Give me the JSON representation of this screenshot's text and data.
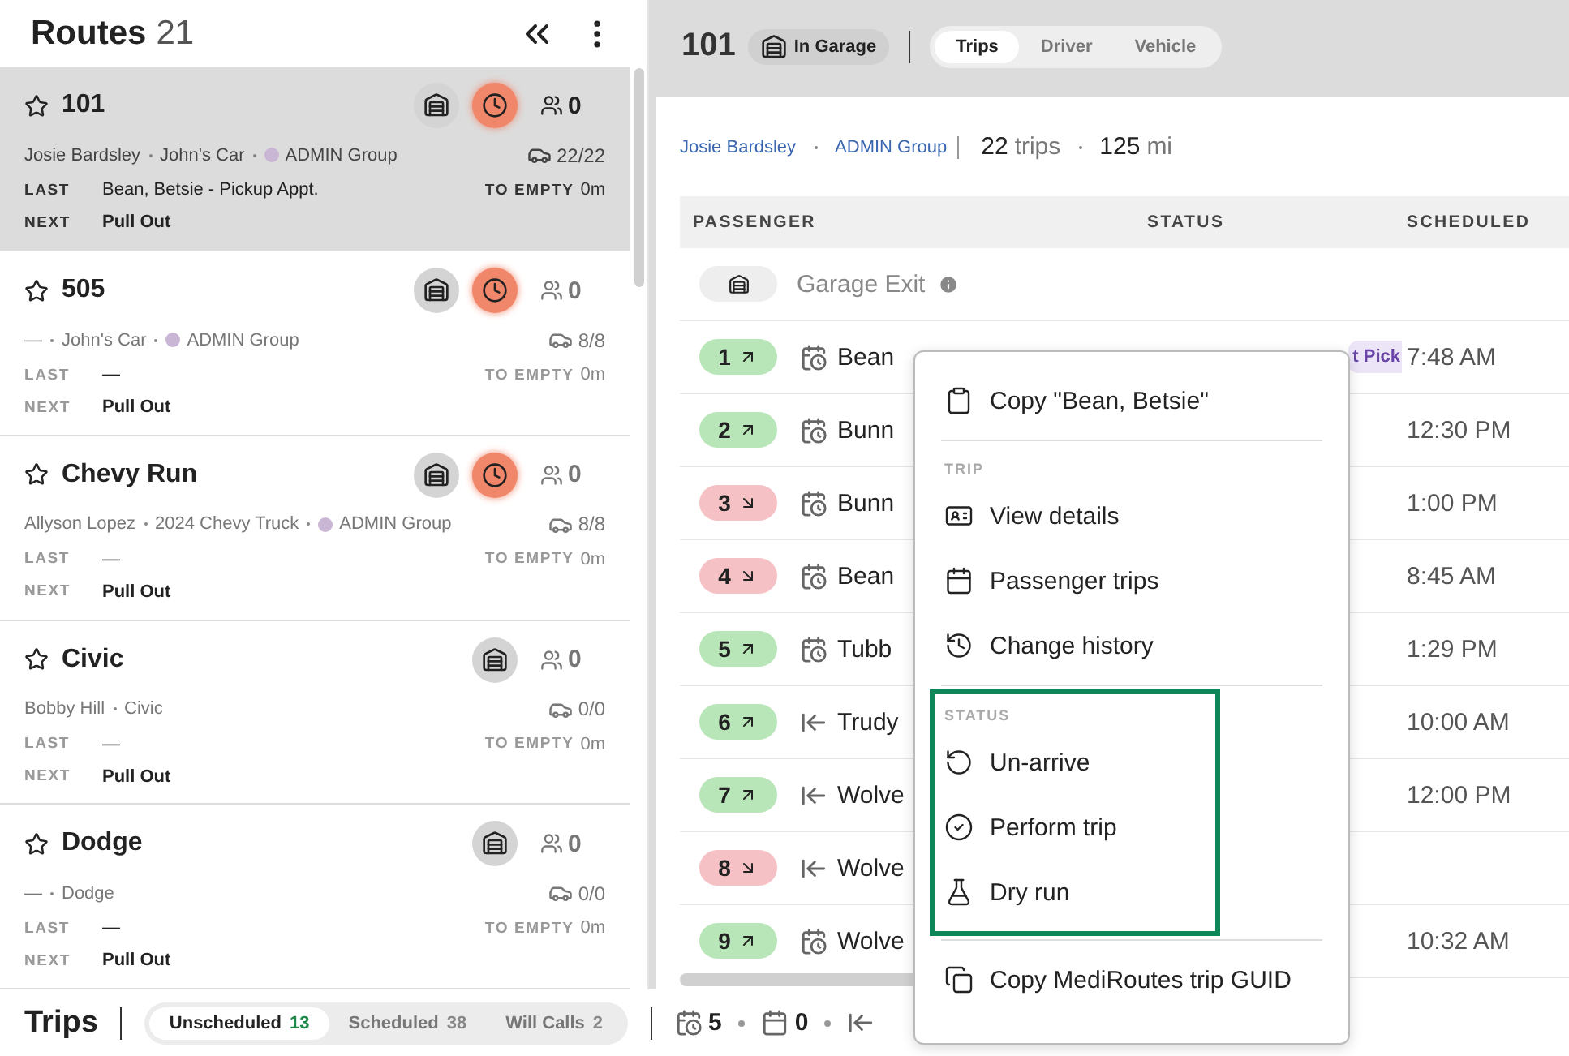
{
  "routes_header": {
    "title": "Routes",
    "count": "21"
  },
  "routes": [
    {
      "name": "101",
      "selected": true,
      "late": true,
      "passengers": "0",
      "details": [
        {
          "text": "Josie Bardsley"
        },
        {
          "text": "John's Car"
        },
        {
          "text": "ADMIN Group",
          "color": "#c9b6d4"
        }
      ],
      "capacity": "22/22",
      "last_label": "LAST",
      "last": "Bean, Betsie - Pickup Appt.",
      "to_empty_label": "TO EMPTY",
      "to_empty": "0m",
      "next_label": "NEXT",
      "next": "Pull Out"
    },
    {
      "name": "505",
      "selected": false,
      "late": true,
      "passengers": "0",
      "details": [
        {
          "text": "—"
        },
        {
          "text": "John's Car"
        },
        {
          "text": "ADMIN Group",
          "color": "#c9b6d4"
        }
      ],
      "capacity": "8/8",
      "last_label": "LAST",
      "last": "—",
      "to_empty_label": "TO EMPTY",
      "to_empty": "0m",
      "next_label": "NEXT",
      "next": "Pull Out"
    },
    {
      "name": "Chevy Run",
      "selected": false,
      "late": true,
      "passengers": "0",
      "details": [
        {
          "text": "Allyson Lopez"
        },
        {
          "text": "2024 Chevy Truck"
        },
        {
          "text": "ADMIN Group",
          "color": "#c9b6d4"
        }
      ],
      "capacity": "8/8",
      "last_label": "LAST",
      "last": "—",
      "to_empty_label": "TO EMPTY",
      "to_empty": "0m",
      "next_label": "NEXT",
      "next": "Pull Out"
    },
    {
      "name": "Civic",
      "selected": false,
      "late": false,
      "passengers": "0",
      "details": [
        {
          "text": "Bobby Hill"
        },
        {
          "text": "Civic"
        }
      ],
      "capacity": "0/0",
      "last_label": "LAST",
      "last": "—",
      "to_empty_label": "TO EMPTY",
      "to_empty": "0m",
      "next_label": "NEXT",
      "next": "Pull Out"
    },
    {
      "name": "Dodge",
      "selected": false,
      "late": false,
      "passengers": "0",
      "details": [
        {
          "text": "—"
        },
        {
          "text": "Dodge"
        }
      ],
      "capacity": "0/0",
      "last_label": "LAST",
      "last": "—",
      "to_empty_label": "TO EMPTY",
      "to_empty": "0m",
      "next_label": "NEXT",
      "next": "Pull Out"
    }
  ],
  "detail_header": {
    "route": "101",
    "status": "In Garage",
    "tabs": [
      {
        "label": "Trips",
        "selected": true
      },
      {
        "label": "Driver",
        "selected": false
      },
      {
        "label": "Vehicle",
        "selected": false
      }
    ]
  },
  "summary": {
    "driver": "Josie Bardsley",
    "group": "ADMIN Group",
    "trips": "22",
    "trips_unit": "trips",
    "miles": "125",
    "miles_unit": "mi"
  },
  "table": {
    "columns": [
      "PASSENGER",
      "STATUS",
      "SCHEDULED"
    ],
    "garage_row": {
      "label": "Garage Exit"
    },
    "rows": [
      {
        "number": "1",
        "pickup": true,
        "kind": "appointment",
        "passenger": "Bean",
        "status": "t Pick",
        "scheduled": "7:48 AM"
      },
      {
        "number": "2",
        "pickup": true,
        "kind": "appointment",
        "passenger": "Bunn",
        "scheduled": "12:30 PM"
      },
      {
        "number": "3",
        "pickup": false,
        "kind": "appointment",
        "passenger": "Bunn",
        "scheduled": "1:00 PM"
      },
      {
        "number": "4",
        "pickup": false,
        "kind": "appointment",
        "passenger": "Bean",
        "scheduled": "8:45 AM"
      },
      {
        "number": "5",
        "pickup": true,
        "kind": "appointment",
        "passenger": "Tubb",
        "scheduled": "1:29 PM"
      },
      {
        "number": "6",
        "pickup": true,
        "kind": "return",
        "passenger": "Trudy",
        "scheduled": "10:00 AM"
      },
      {
        "number": "7",
        "pickup": true,
        "kind": "return",
        "passenger": "Wolve",
        "scheduled": "12:00 PM"
      },
      {
        "number": "8",
        "pickup": false,
        "kind": "return",
        "passenger": "Wolve"
      },
      {
        "number": "9",
        "pickup": true,
        "kind": "appointment",
        "passenger": "Wolve",
        "scheduled": "10:32 AM"
      }
    ]
  },
  "bottom_bar": {
    "title": "Trips",
    "tabs": [
      {
        "label": "Unscheduled",
        "count": "13",
        "selected": true
      },
      {
        "label": "Scheduled",
        "count": "38",
        "selected": false
      },
      {
        "label": "Will Calls",
        "count": "2",
        "selected": false
      }
    ],
    "counts": [
      {
        "kind": "appointment",
        "value": "5"
      },
      {
        "kind": "calendar",
        "value": "0"
      },
      {
        "kind": "return"
      }
    ]
  },
  "context_menu": {
    "groups": [
      {
        "highlighted": false,
        "items": [
          {
            "kind": "clipboard",
            "label": "Copy \"Bean, Betsie\""
          }
        ]
      },
      {
        "heading": "TRIP",
        "highlighted": false,
        "items": [
          {
            "kind": "card",
            "label": "View details"
          },
          {
            "kind": "calendar",
            "label": "Passenger trips"
          },
          {
            "kind": "history",
            "label": "Change history"
          }
        ]
      },
      {
        "heading": "STATUS",
        "highlighted": true,
        "items": [
          {
            "kind": "undo",
            "label": "Un-arrive"
          },
          {
            "kind": "check",
            "label": "Perform trip"
          },
          {
            "kind": "flask",
            "label": "Dry run"
          }
        ]
      },
      {
        "highlighted": false,
        "items": [
          {
            "kind": "copy",
            "label": "Copy MediRoutes trip GUID"
          }
        ]
      }
    ]
  }
}
